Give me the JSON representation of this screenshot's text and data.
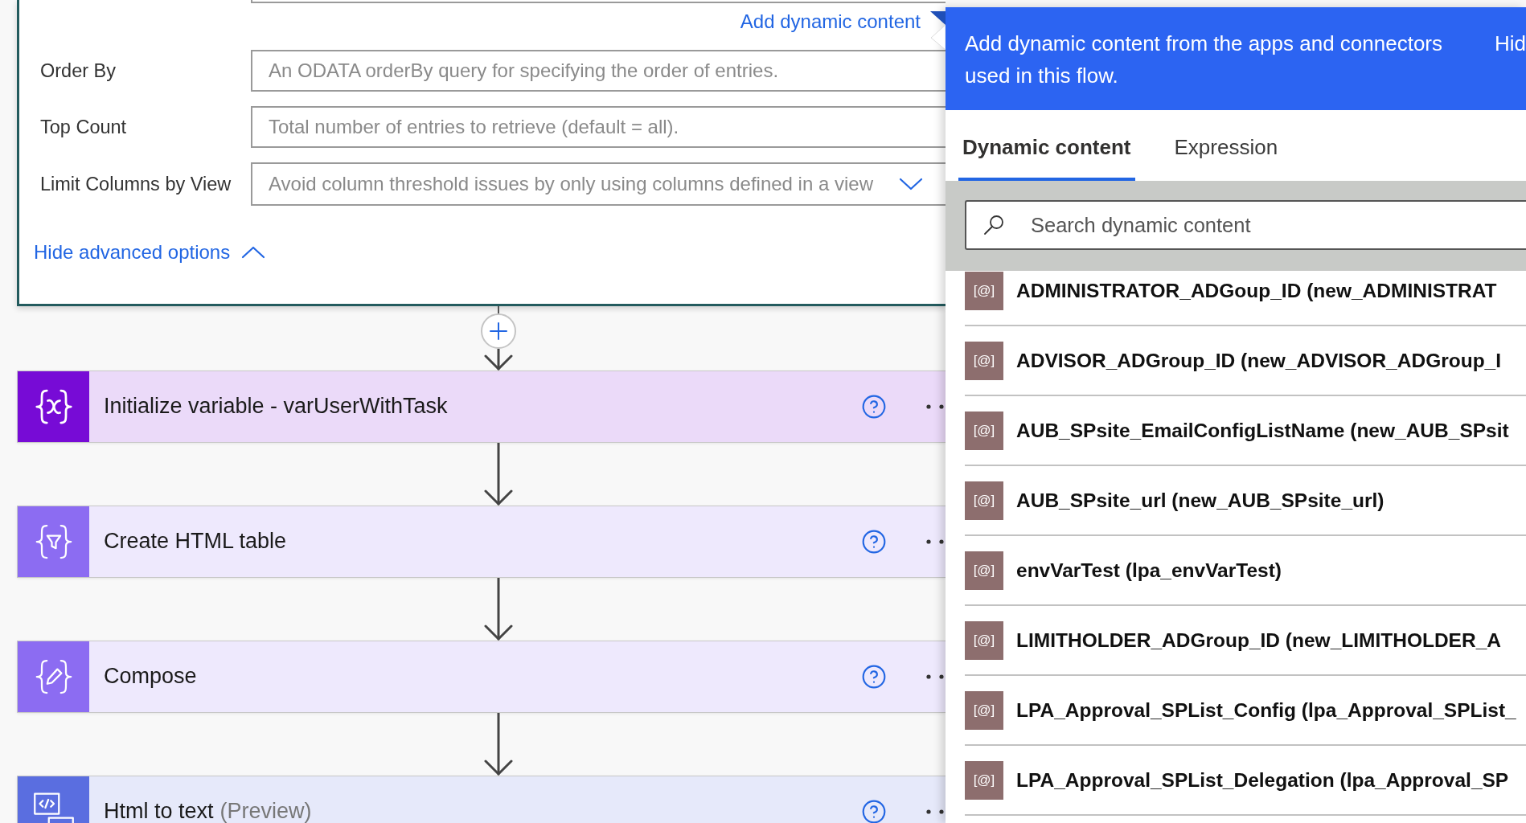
{
  "action_card": {
    "link": "Add dynamic content",
    "fields": [
      {
        "kind": "text",
        "label": "Order By",
        "placeholder": "An ODATA orderBy query for specifying the order of entries."
      },
      {
        "kind": "text",
        "label": "Top Count",
        "placeholder": "Total number of entries to retrieve (default = all)."
      },
      {
        "kind": "dropdown",
        "label": "Limit Columns by View",
        "placeholder": "Avoid column threshold issues by only using columns defined in a view"
      }
    ],
    "toggle": {
      "label": "Hide advanced options",
      "expanded": true
    }
  },
  "steps": [
    {
      "kind": "variable",
      "title": "Initialize variable - varUserWithTask",
      "color": "#770bd6"
    },
    {
      "kind": "table",
      "title": "Create HTML table",
      "color": "#8c6cf2"
    },
    {
      "kind": "compose",
      "title": "Compose",
      "color": "#8c6cf2"
    },
    {
      "kind": "html",
      "title": "Html to text",
      "suffix": "(Preview)",
      "color": "#5a6ee0"
    }
  ],
  "dynamic_panel": {
    "header": "Add dynamic content from the apps and connectors used in this flow.",
    "hide_link": "Hid",
    "tabs": [
      {
        "label": "Dynamic content",
        "selected": true
      },
      {
        "label": "Expression",
        "selected": false
      }
    ],
    "search": {
      "placeholder": "Search dynamic content"
    },
    "items": [
      {
        "badge": "[@]",
        "label": "ADMINISTRATOR_ADGoup_ID (new_ADMINISTRAT"
      },
      {
        "badge": "[@]",
        "label": "ADVISOR_ADGroup_ID (new_ADVISOR_ADGroup_I"
      },
      {
        "badge": "[@]",
        "label": "AUB_SPsite_EmailConfigListName (new_AUB_SPsit"
      },
      {
        "badge": "[@]",
        "label": "AUB_SPsite_url (new_AUB_SPsite_url)"
      },
      {
        "badge": "[@]",
        "label": "envVarTest (lpa_envVarTest)"
      },
      {
        "badge": "[@]",
        "label": "LIMITHOLDER_ADGroup_ID (new_LIMITHOLDER_A"
      },
      {
        "badge": "[@]",
        "label": "LPA_Approval_SPList_Config (lpa_Approval_SPList_"
      },
      {
        "badge": "[@]",
        "label": "LPA_Approval_SPList_Delegation (lpa_Approval_SP"
      }
    ]
  }
}
